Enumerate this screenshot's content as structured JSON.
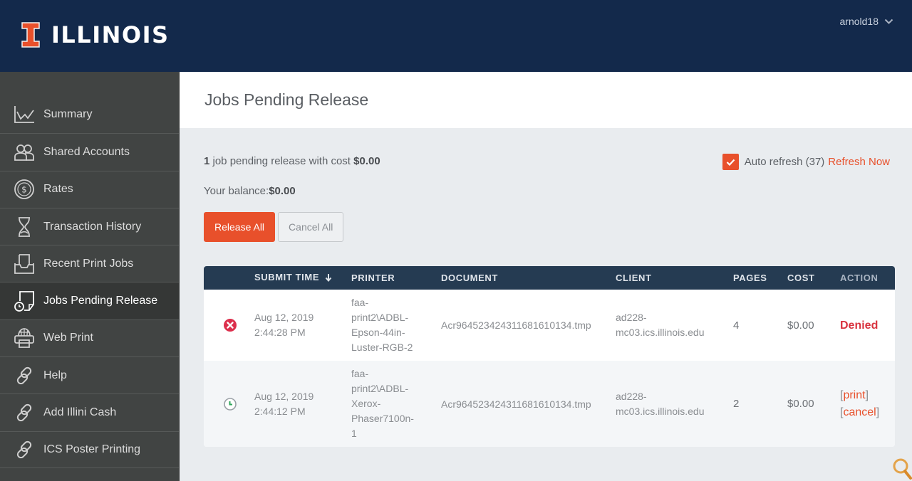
{
  "header": {
    "brand": "ILLINOIS",
    "brand_colors": {
      "navy": "#13294b",
      "orange": "#e8502b"
    },
    "user": "arnold18"
  },
  "sidebar": {
    "items": [
      {
        "label": "Summary",
        "icon": "chart-line-icon",
        "active": false
      },
      {
        "label": "Shared Accounts",
        "icon": "users-icon",
        "active": false
      },
      {
        "label": "Rates",
        "icon": "dollar-circle-icon",
        "active": false
      },
      {
        "label": "Transaction History",
        "icon": "hourglass-icon",
        "active": false
      },
      {
        "label": "Recent Print Jobs",
        "icon": "inbox-tray-icon",
        "active": false
      },
      {
        "label": "Jobs Pending Release",
        "icon": "document-clock-icon",
        "active": true
      },
      {
        "label": "Web Print",
        "icon": "web-printer-icon",
        "active": false
      },
      {
        "label": "Help",
        "icon": "link-icon",
        "active": false
      },
      {
        "label": "Add Illini Cash",
        "icon": "link-icon",
        "active": false
      },
      {
        "label": "ICS Poster Printing",
        "icon": "link-icon",
        "active": false
      }
    ]
  },
  "main": {
    "title": "Jobs Pending Release",
    "summary": {
      "count": "1",
      "text": " job pending release with cost ",
      "cost": "$0.00"
    },
    "balance": {
      "label": "Your balance:",
      "value": "$0.00"
    },
    "auto_refresh": {
      "checked": true,
      "label": "Auto refresh (37)",
      "refresh_now": "Refresh Now"
    },
    "buttons": {
      "release_all": "Release All",
      "cancel_all": "Cancel All"
    },
    "table": {
      "columns": [
        "",
        "SUBMIT TIME",
        "PRINTER",
        "DOCUMENT",
        "CLIENT",
        "PAGES",
        "COST",
        "ACTION"
      ],
      "sort_column": "SUBMIT TIME",
      "sort_direction": "descending",
      "rows": [
        {
          "status": "denied",
          "status_icon": "x-circle-icon",
          "date": "Aug 12, 2019",
          "time": "2:44:28 PM",
          "printer": "faa-print2\\ADBL-Epson-44in-Luster-RGB-2",
          "printer_lines": [
            "faa-",
            "print2\\ADBL-",
            "Epson-44in-",
            "Luster-RGB-2"
          ],
          "document": "Acr964523424311681610134.tmp",
          "client_lines": [
            "ad228-",
            "mc03.ics.illinois.edu"
          ],
          "pages": "4",
          "cost": "$0.00",
          "action": "Denied"
        },
        {
          "status": "pending",
          "status_icon": "clock-icon",
          "date": "Aug 12, 2019",
          "time": "2:44:12 PM",
          "printer": "faa-print2\\ADBL-Xerox-Phaser7100n-1",
          "printer_lines": [
            "faa-",
            "print2\\ADBL-",
            "Xerox-",
            "Phaser7100n-",
            "1"
          ],
          "document": "Acr964523424311681610134.tmp",
          "client_lines": [
            "ad228-",
            "mc03.ics.illinois.edu"
          ],
          "pages": "2",
          "cost": "$0.00",
          "actions": [
            "print",
            "cancel"
          ]
        }
      ]
    }
  }
}
